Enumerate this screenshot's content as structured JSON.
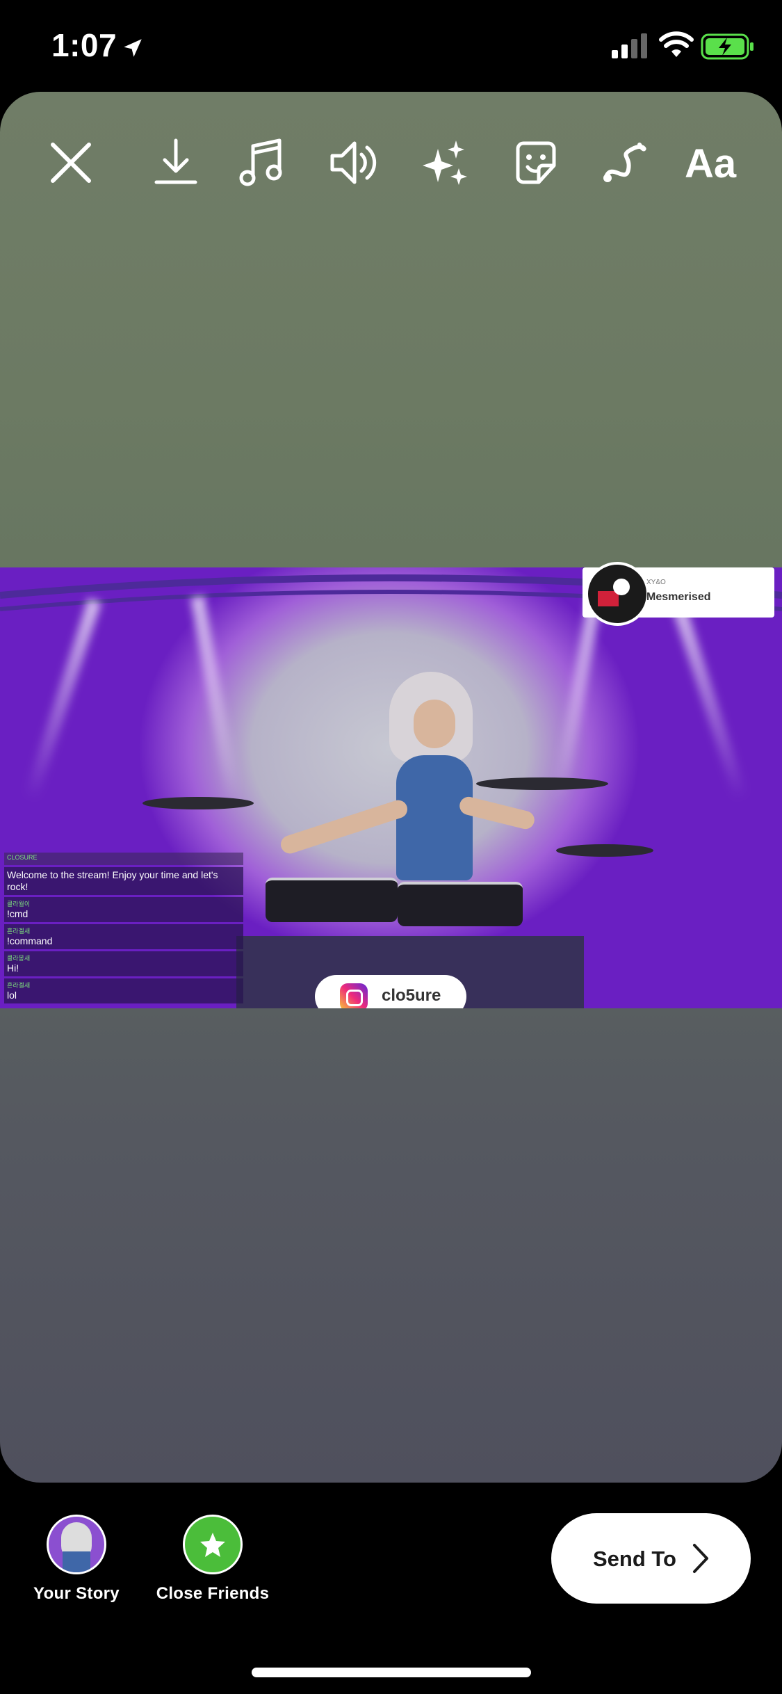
{
  "status_bar": {
    "time": "1:07"
  },
  "toolbar": {
    "icons": [
      "close-icon",
      "download-icon",
      "music-icon",
      "sound-icon",
      "effects-icon",
      "sticker-icon",
      "draw-icon",
      "text-icon"
    ],
    "text_label": "Aa"
  },
  "stream": {
    "chat": {
      "header_tag": "CLOSURE",
      "messages": [
        {
          "user": "",
          "text": "Welcome to the stream! Enjoy your time and let's rock!"
        },
        {
          "user": "클라월이",
          "text": "!cmd"
        },
        {
          "user": "흔라겔새",
          "text": "!command"
        },
        {
          "user": "클라몽새",
          "text": "Hi!"
        },
        {
          "user": "흔라겔새",
          "text": "lol"
        }
      ]
    },
    "instagram_handle": "clo5ure",
    "now_playing": {
      "artist": "XY&O",
      "title": "Mesmerised"
    }
  },
  "share": {
    "your_story": "Your Story",
    "close_friends": "Close Friends"
  },
  "send_button": {
    "label": "Send To"
  }
}
